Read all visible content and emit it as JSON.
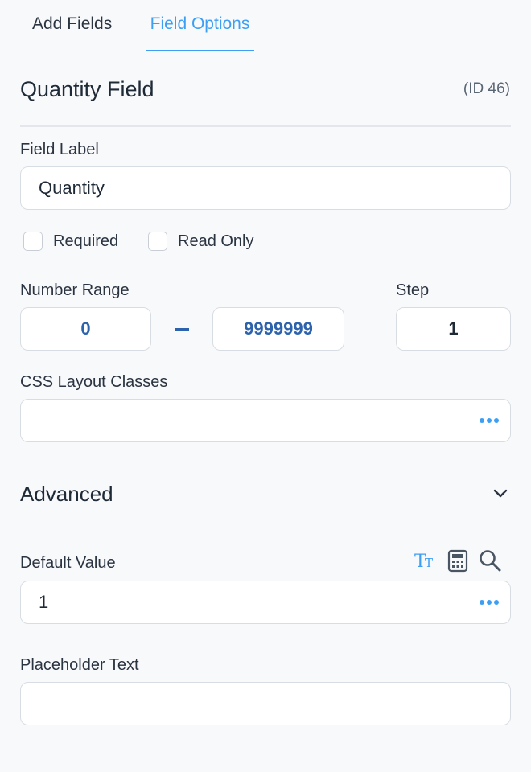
{
  "tabs": {
    "add_fields": "Add Fields",
    "field_options": "Field Options"
  },
  "field": {
    "title": "Quantity Field",
    "id_text": "(ID 46)"
  },
  "field_label": {
    "label": "Field Label",
    "value": "Quantity"
  },
  "options": {
    "required": "Required",
    "read_only": "Read Only"
  },
  "number_range": {
    "label": "Number Range",
    "min": "0",
    "max": "9999999"
  },
  "step": {
    "label": "Step",
    "value": "1"
  },
  "css_classes": {
    "label": "CSS Layout Classes",
    "value": ""
  },
  "advanced": {
    "label": "Advanced"
  },
  "default_value": {
    "label": "Default Value",
    "value": "1"
  },
  "placeholder_text": {
    "label": "Placeholder Text",
    "value": ""
  },
  "icons": {
    "text_tool": "text-format-icon",
    "calculator": "calculator-icon",
    "search": "search-icon",
    "more": "more-dots-icon",
    "chevron": "chevron-down-icon"
  },
  "colors": {
    "accent": "#3d9ff3",
    "range_text": "#2d63ad",
    "background": "#f8f9fb"
  }
}
